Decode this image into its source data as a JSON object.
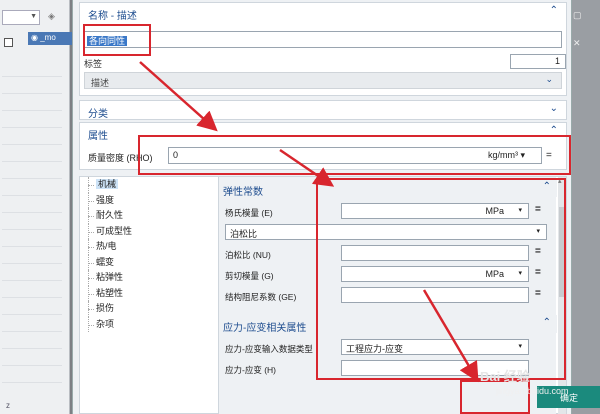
{
  "colors": {
    "accent": "#1e4d8f",
    "annotation_red": "#d8262e",
    "ok_button": "#1b8a7d",
    "selection": "#3a78c8"
  },
  "background": {
    "tab_label": "_mo",
    "bottom_label": "z"
  },
  "dialog": {
    "name_section": {
      "title": "名称 - 描述",
      "name_value": "各向同性",
      "label_caption": "标签",
      "label_value": "1",
      "description_label": "描述"
    },
    "category": {
      "title": "分类"
    },
    "properties": {
      "title": "属性",
      "density_label": "质量密度 (RHO)",
      "density_value": "0",
      "density_unit": "kg/mm³",
      "density_unit_dropdown_icon": "dropdown-icon",
      "density_menu_icon": "menu-icon"
    },
    "tree": {
      "items": [
        "机械",
        "强度",
        "耐久性",
        "可成型性",
        "热/电",
        "蠕变",
        "粘弹性",
        "粘塑性",
        "损伤",
        "杂项"
      ],
      "selected_index": 0
    },
    "elastic": {
      "title": "弹性常数",
      "fields": [
        {
          "label": "杨氏模量 (E)",
          "value": "",
          "unit": "MPa",
          "has_unit": true
        },
        {
          "label": "",
          "value": "泊松比",
          "unit": "",
          "has_unit": false,
          "full": true
        },
        {
          "label": "泊松比 (NU)",
          "value": "",
          "unit": "",
          "has_unit": false
        },
        {
          "label": "剪切模量 (G)",
          "value": "",
          "unit": "MPa",
          "has_unit": true
        },
        {
          "label": "结构阻尼系数 (GE)",
          "value": "",
          "unit": "",
          "has_unit": false
        }
      ]
    },
    "stress_strain": {
      "title": "应力-应变相关属性",
      "input_type_label": "应力-应变输入数据类型",
      "input_type_value": "工程应力-应变",
      "curve_label": "应力-应变 (H)"
    },
    "ok_label": "确定"
  },
  "watermark": {
    "brand": "Bai 经验",
    "url": "jingyan.baidu.com"
  }
}
